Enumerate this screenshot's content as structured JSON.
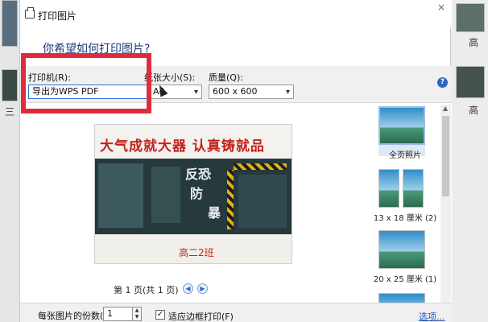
{
  "window": {
    "title": "打印图片",
    "close": "×"
  },
  "question": "你希望如何打印图片?",
  "options": {
    "printer": {
      "label": "打印机(R):",
      "value": "导出为WPS PDF"
    },
    "paper": {
      "label": "纸张大小(S):",
      "value": "A4"
    },
    "quality": {
      "label": "质量(Q):",
      "value": "600 x 600"
    },
    "help_icon": "?"
  },
  "preview": {
    "banner_text": "大气成就大器  认真铸就品",
    "board_text_1": "反恐",
    "board_text_2": "防",
    "board_text_3": "暴",
    "class_label": "高二2班",
    "page_info": "第 1 页(共 1 页)"
  },
  "layouts": [
    {
      "label": "全页照片",
      "selected": true
    },
    {
      "label": "13 x 18 厘米 (2)",
      "selected": false
    },
    {
      "label": "20 x 25 厘米 (1)",
      "selected": false
    },
    {
      "label": "",
      "selected": false
    }
  ],
  "bottom": {
    "copies_label": "每张图片的份数(C):",
    "copies_value": "1",
    "fit_label": "适应边框打印(F)",
    "fit_checked": true,
    "options_link": "选项..."
  },
  "background": {
    "right_label_1": "高",
    "right_label_2": "高",
    "left_label": "三"
  },
  "colors": {
    "highlight": "#e02b3c",
    "accent": "#2b67c6",
    "title_text": "#1e3a78"
  }
}
